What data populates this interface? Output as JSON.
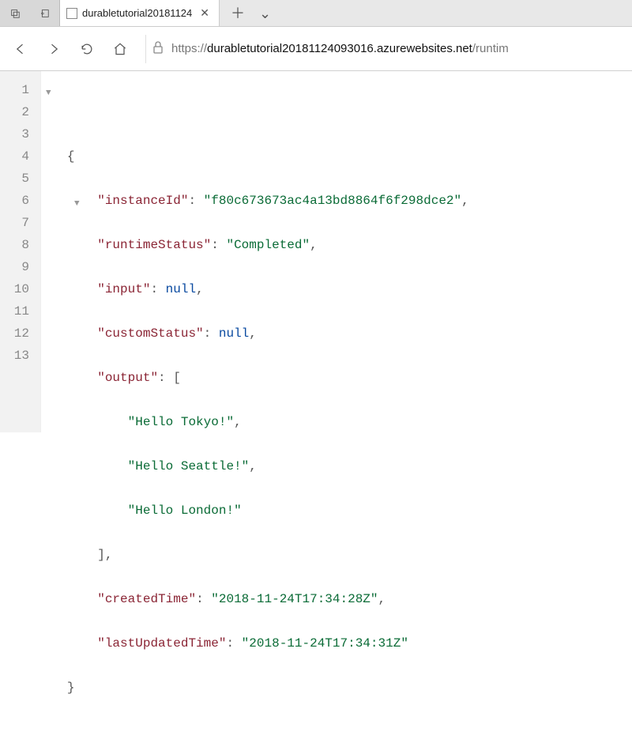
{
  "tab": {
    "title": "durabletutorial20181124"
  },
  "url": {
    "scheme": "https://",
    "host": "durabletutorial20181124093016.azurewebsites.net",
    "path": "/runtim"
  },
  "json": {
    "instanceId_key": "instanceId",
    "instanceId_val": "f80c673673ac4a13bd8864f6f298dce2",
    "runtimeStatus_key": "runtimeStatus",
    "runtimeStatus_val": "Completed",
    "input_key": "input",
    "input_val": "null",
    "customStatus_key": "customStatus",
    "customStatus_val": "null",
    "output_key": "output",
    "output_0": "Hello Tokyo!",
    "output_1": "Hello Seattle!",
    "output_2": "Hello London!",
    "createdTime_key": "createdTime",
    "createdTime_val": "2018-11-24T17:34:28Z",
    "lastUpdatedTime_key": "lastUpdatedTime",
    "lastUpdatedTime_val": "2018-11-24T17:34:31Z"
  },
  "lines": [
    "1",
    "2",
    "3",
    "4",
    "5",
    "6",
    "7",
    "8",
    "9",
    "10",
    "11",
    "12",
    "13"
  ]
}
